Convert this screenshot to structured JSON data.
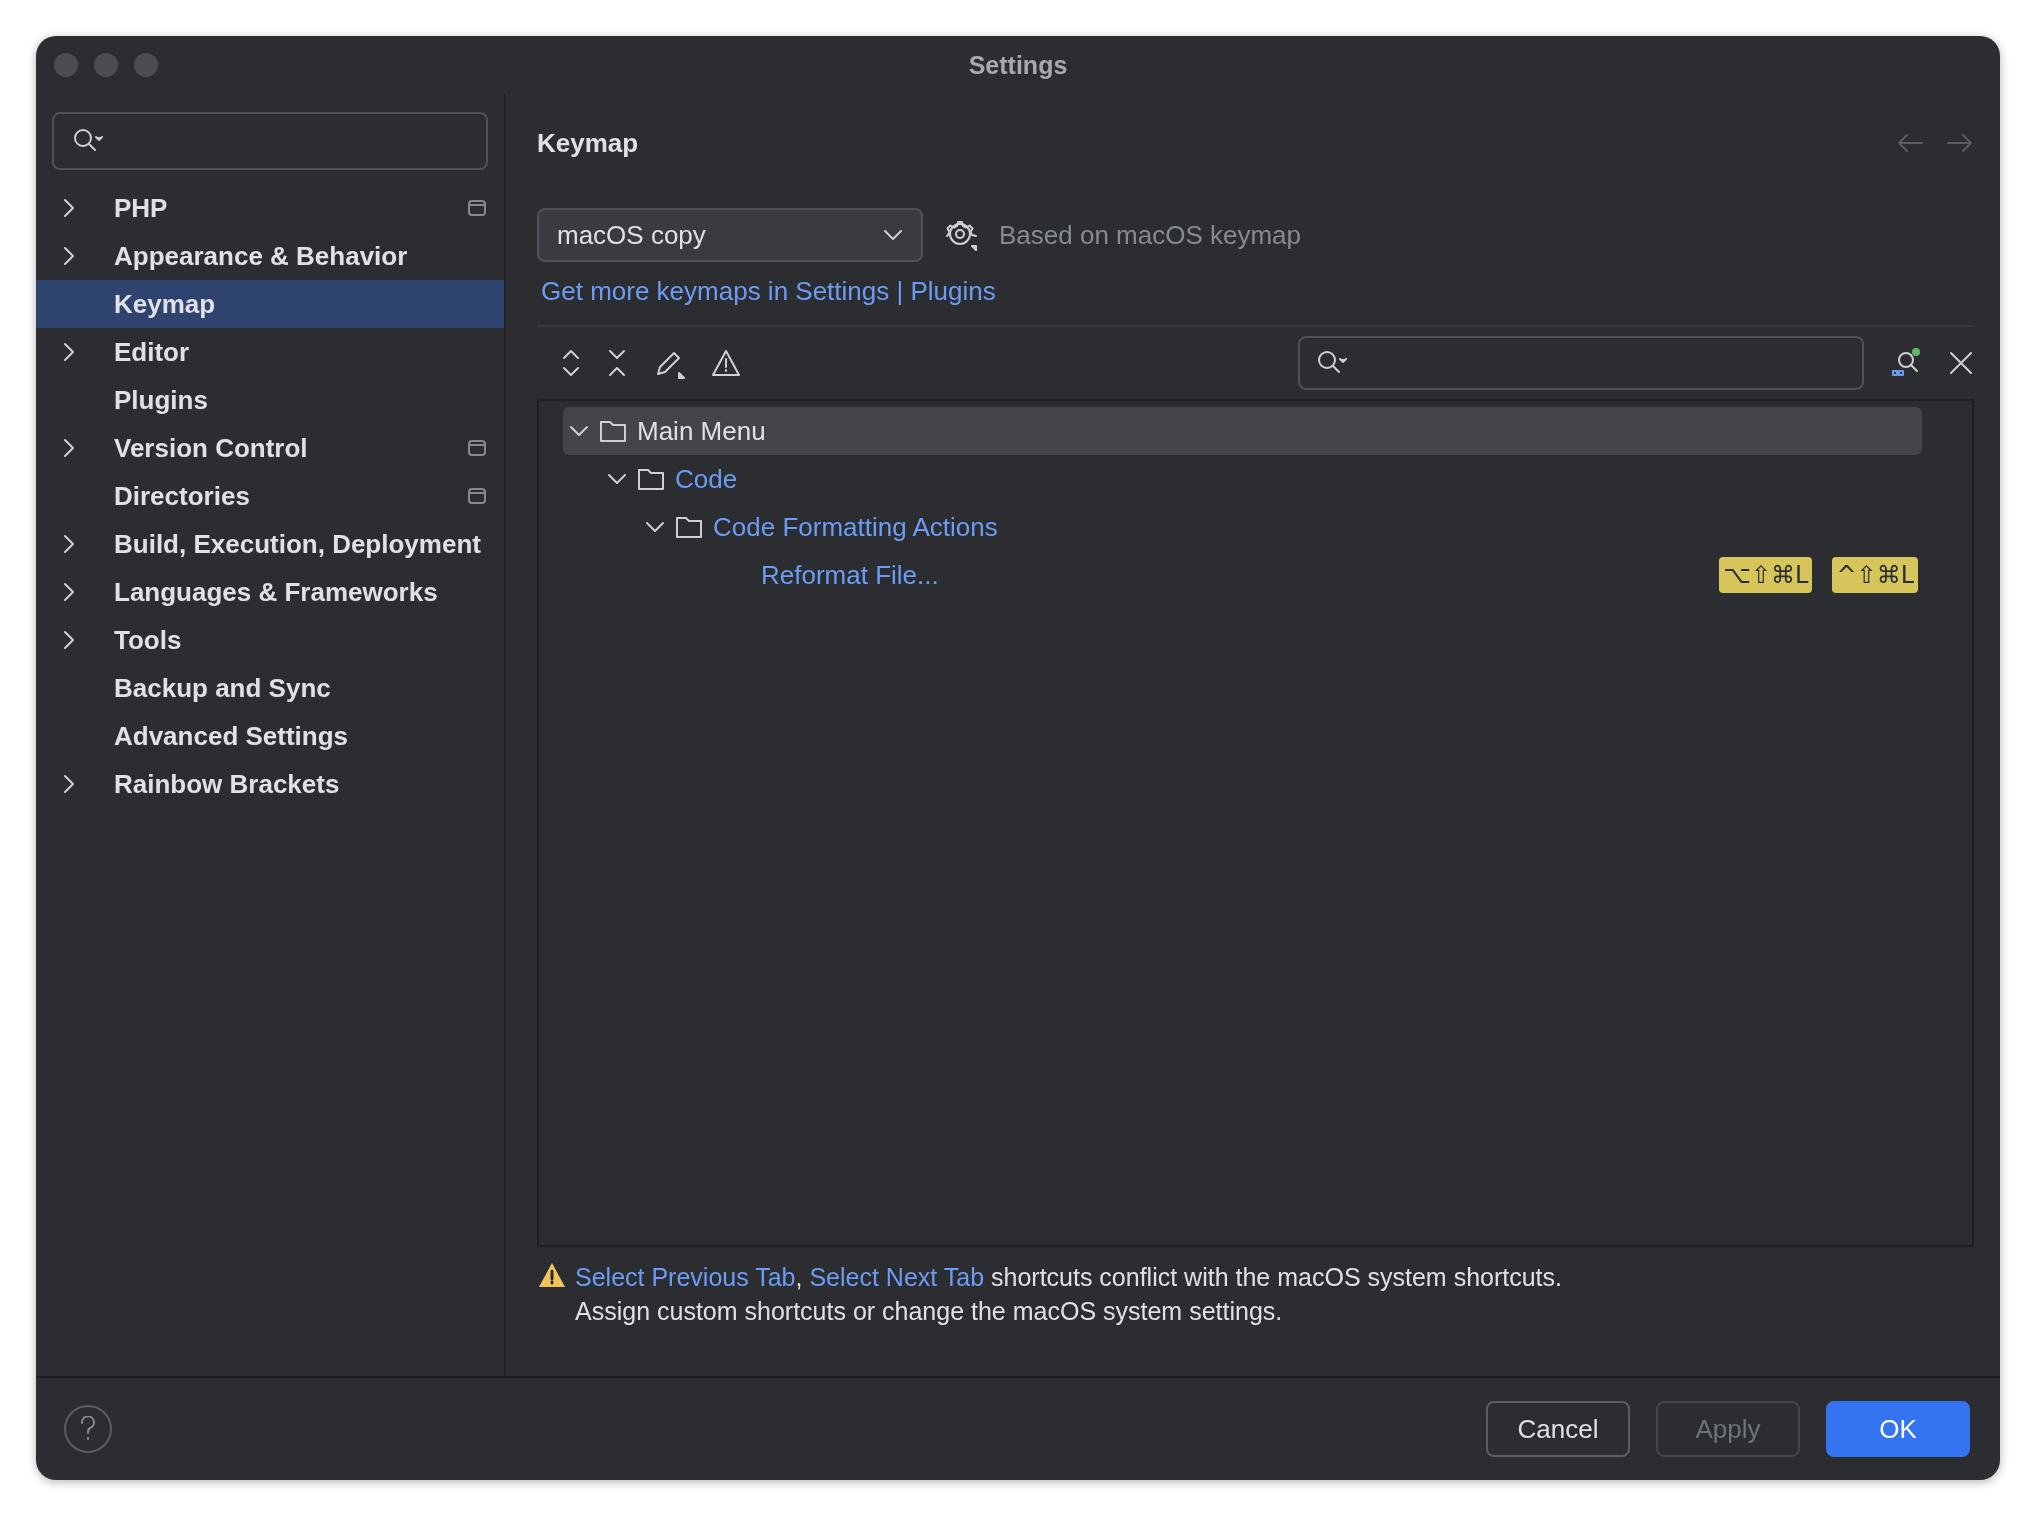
{
  "window": {
    "title": "Settings"
  },
  "sidebar": {
    "items": [
      {
        "label": "PHP",
        "kind": "group",
        "project_level": true,
        "selected": false
      },
      {
        "label": "Appearance & Behavior",
        "kind": "group",
        "project_level": false,
        "selected": false
      },
      {
        "label": "Keymap",
        "kind": "page",
        "project_level": false,
        "selected": true
      },
      {
        "label": "Editor",
        "kind": "group",
        "project_level": false,
        "selected": false
      },
      {
        "label": "Plugins",
        "kind": "page",
        "project_level": false,
        "selected": false
      },
      {
        "label": "Version Control",
        "kind": "group",
        "project_level": true,
        "selected": false
      },
      {
        "label": "Directories",
        "kind": "page",
        "project_level": true,
        "selected": false
      },
      {
        "label": "Build, Execution, Deployment",
        "kind": "group",
        "project_level": false,
        "selected": false
      },
      {
        "label": "Languages & Frameworks",
        "kind": "group",
        "project_level": false,
        "selected": false
      },
      {
        "label": "Tools",
        "kind": "group",
        "project_level": false,
        "selected": false
      },
      {
        "label": "Backup and Sync",
        "kind": "page",
        "project_level": false,
        "selected": false
      },
      {
        "label": "Advanced Settings",
        "kind": "page",
        "project_level": false,
        "selected": false
      },
      {
        "label": "Rainbow Brackets",
        "kind": "group",
        "project_level": false,
        "selected": false
      }
    ]
  },
  "main": {
    "title": "Keymap",
    "keymap": {
      "value": "macOS copy"
    },
    "based_on": "Based on macOS keymap",
    "plugins_link": "Get more keymaps in Settings | Plugins",
    "tree": [
      {
        "label": "Main Menu",
        "kind": "folder",
        "expanded": true,
        "selected": true,
        "modified": false,
        "children": [
          {
            "label": "Code",
            "kind": "folder",
            "expanded": true,
            "selected": false,
            "modified": true,
            "children": [
              {
                "label": "Code Formatting Actions",
                "kind": "folder",
                "expanded": true,
                "selected": false,
                "modified": true,
                "children": [
                  {
                    "label": "Reformat File...",
                    "kind": "action",
                    "selected": false,
                    "modified": true,
                    "shortcuts": [
                      "⌥⇧⌘L",
                      "^⇧⌘L"
                    ]
                  }
                ]
              }
            ]
          }
        ]
      }
    ],
    "warning": {
      "parts": [
        {
          "kind": "link",
          "text": "Select Previous Tab",
          "after": ", "
        },
        {
          "kind": "link",
          "text": "Select Next Tab"
        },
        {
          "kind": "text",
          "text": " shortcuts conflict with the macOS system shortcuts."
        }
      ],
      "line2": "Assign custom shortcuts or change the macOS system settings."
    }
  },
  "buttons": [
    {
      "label": "Cancel",
      "kind": "default"
    },
    {
      "label": "Apply",
      "kind": "disabled"
    },
    {
      "label": "OK",
      "kind": "primary"
    }
  ]
}
